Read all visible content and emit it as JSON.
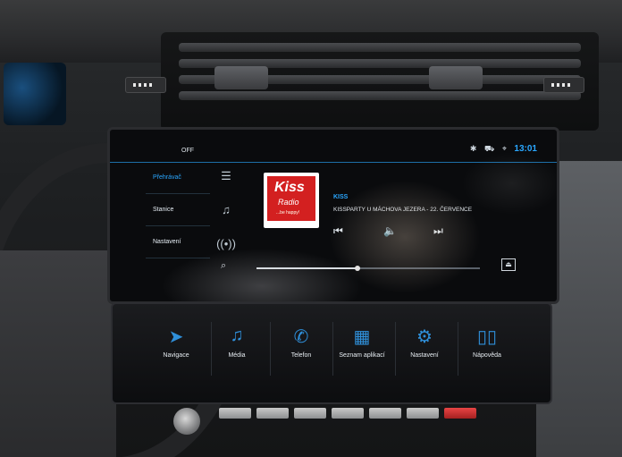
{
  "screen": {
    "off_label": "OFF",
    "clock": "13:01",
    "status_icons": [
      "bluetooth-icon",
      "car-icon",
      "location-icon"
    ]
  },
  "left_menu": [
    {
      "label": "Přehrávač",
      "active": true
    },
    {
      "label": "Stanice",
      "active": false
    },
    {
      "label": "Nastavení",
      "active": false
    }
  ],
  "sidebar_icons": [
    "menu-icon",
    "music-file-icon",
    "radio-icon"
  ],
  "now_playing": {
    "station": "KISS",
    "track": "KISSPARTY U MÁCHOVA JEZERA - 22. ČERVENCE",
    "logo": {
      "line1": "Kiss",
      "line2": "Radio",
      "tagline": "...be happy!"
    },
    "progress": 0.45
  },
  "controls": [
    "previous-icon",
    "volume-icon",
    "next-icon"
  ],
  "bottom_bar": [
    {
      "label": "Navigace",
      "icon": "navigation-arrow-icon"
    },
    {
      "label": "Média",
      "icon": "music-note-icon"
    },
    {
      "label": "Telefon",
      "icon": "phone-icon"
    },
    {
      "label": "Seznam aplikací",
      "icon": "apps-grid-icon"
    },
    {
      "label": "Nastavení",
      "icon": "gear-icon"
    },
    {
      "label": "Nápověda",
      "icon": "book-icon"
    }
  ],
  "accent_color": "#2aa7ff"
}
